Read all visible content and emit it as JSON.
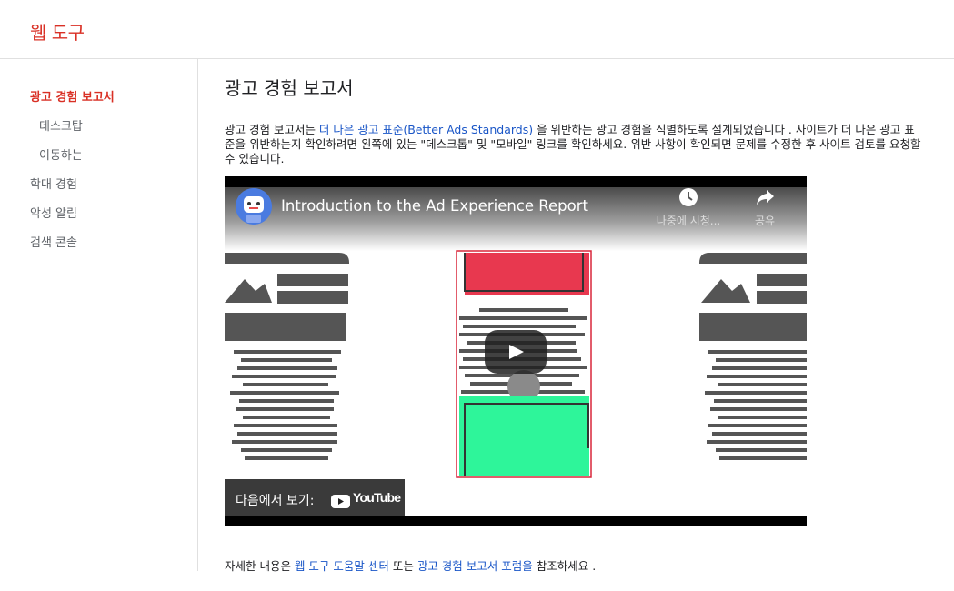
{
  "app": {
    "brand": "웹 도구",
    "accent_color": "#d93025",
    "link_color": "#1a56c7"
  },
  "sidebar": {
    "items": [
      {
        "label": "광고 경험 보고서",
        "active": true
      },
      {
        "label": "데스크탑",
        "active": false
      },
      {
        "label": "이동하는",
        "active": false
      },
      {
        "label": "학대 경험",
        "active": false
      },
      {
        "label": "악성 알림",
        "active": false
      },
      {
        "label": "검색 콘솔",
        "active": false
      }
    ]
  },
  "main": {
    "title": "광고 경험 보고서",
    "intro": {
      "part1": "광고 경험 보고서는 ",
      "link": "더 나은 광고 표준(Better Ads Standards)",
      "part2": " 을 위반하는 광고 경험을 식별하도록 설계되었습니다 . 사이트가 더 나은 광고 표준을 위반하는지 확인하려면 왼쪽에 있는 \"데스크톱\" 및 \"모바일\" 링크를 확인하세요. 위반 사항이 확인되면 문제를 수정한 후 사이트 검토를 요청할 수 있습니다."
    },
    "video": {
      "title": "Introduction to the Ad Experience Report",
      "watch_later": "나중에 시청...",
      "share": "공유",
      "watch_on": "다음에서 보기:",
      "youtube": "YouTube",
      "play_icon": "play-icon"
    },
    "footer": {
      "prefix": "자세한 내용은 ",
      "link1": "웹 도구 도움말 센터",
      "middle": " 또는 ",
      "link2": "광고 경험 보고서 포럼을",
      "suffix": " 참조하세요 ."
    }
  }
}
